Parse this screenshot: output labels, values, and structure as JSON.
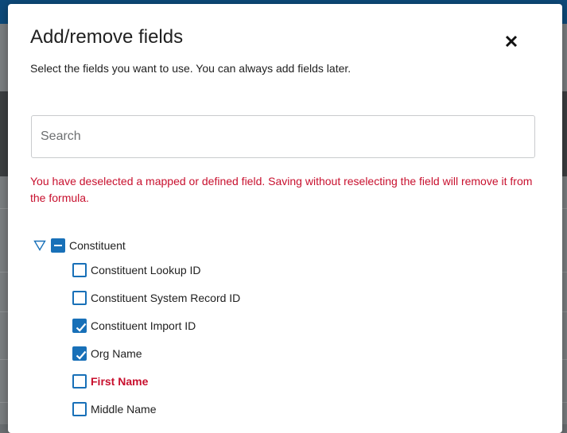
{
  "modal": {
    "title": "Add/remove fields",
    "subtitle": "Select the fields you want to use. You can always add fields later.",
    "close_icon": "close-icon"
  },
  "search": {
    "placeholder": "Search",
    "value": ""
  },
  "warning": "You have deselected a mapped or defined field. Saving without reselecting the field will remove it from the formula.",
  "tree": {
    "parent": {
      "label": "Constituent",
      "expanded": true,
      "state": "indeterminate"
    },
    "items": [
      {
        "label": "Constituent Lookup ID",
        "checked": false
      },
      {
        "label": "Constituent System Record ID",
        "checked": false
      },
      {
        "label": "Constituent Import ID",
        "checked": true
      },
      {
        "label": "Org Name",
        "checked": true
      },
      {
        "label": "First Name",
        "checked": false,
        "error": true
      },
      {
        "label": "Middle Name",
        "checked": false
      }
    ]
  },
  "colors": {
    "accent": "#1870b8",
    "error": "#c8102e",
    "topbar": "#0d4a7a"
  }
}
